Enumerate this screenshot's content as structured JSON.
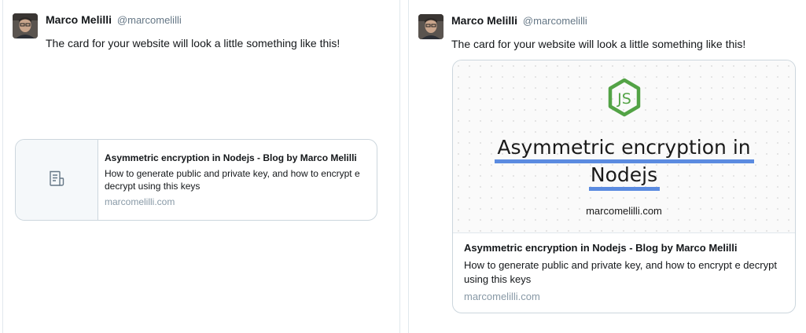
{
  "tweet": {
    "author_name": "Marco Melilli",
    "author_handle": "@marcomelilli",
    "text": "The card for your website will look a little something like this!"
  },
  "summary_card": {
    "title": "Asymmetric encryption in Nodejs - Blog by Marco Melilli",
    "description": "How to generate public and private key, and how to encrypt e decrypt using this keys",
    "domain": "marcomelilli.com",
    "thumb_icon": "document-icon"
  },
  "large_card": {
    "image": {
      "logo": "nodejs-logo",
      "title_line1": "Asymmetric encryption in",
      "title_line2": "Nodejs",
      "domain": "marcomelilli.com",
      "logo_color": "#53a346",
      "underline_color": "#5b8be0"
    },
    "title": "Asymmetric encryption in Nodejs - Blog by Marco Melilli",
    "description": "How to generate public and private key, and how to encrypt e decrypt using this keys",
    "domain": "marcomelilli.com"
  }
}
